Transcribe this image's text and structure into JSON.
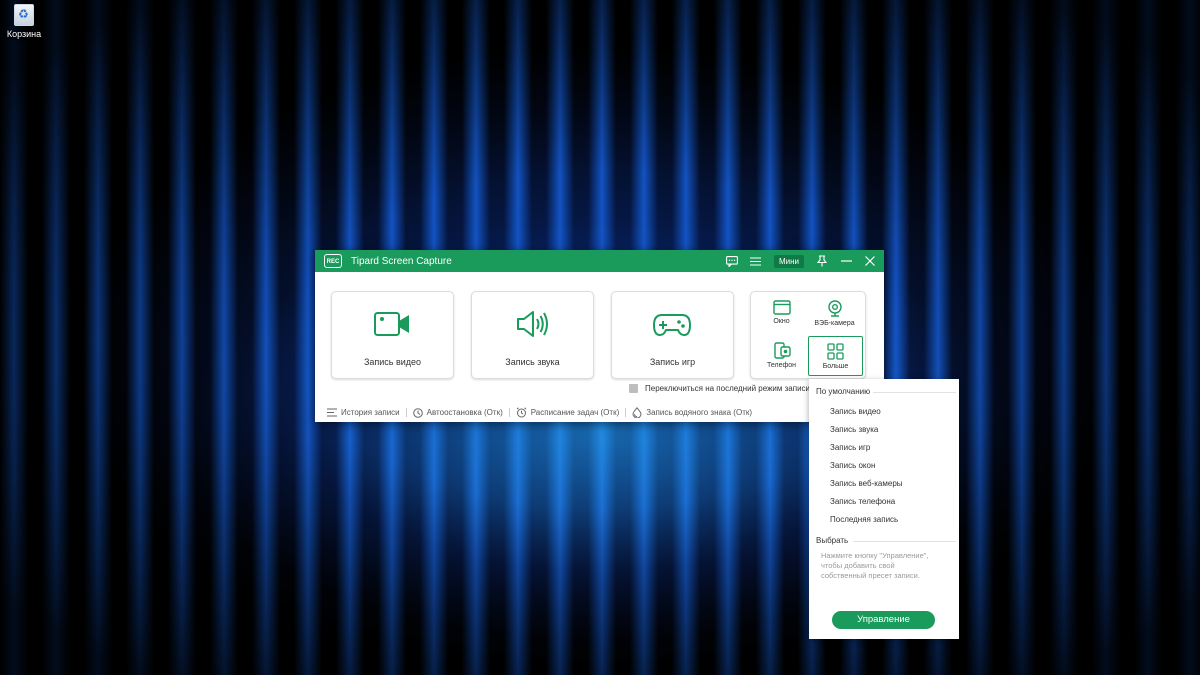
{
  "desktop": {
    "recycle_bin_label": "Корзина"
  },
  "app": {
    "title": "Tipard Screen Capture",
    "logo_text": "REC",
    "mini_label": "Мини",
    "accent": "#1a9b5c",
    "cards": [
      {
        "label": "Запись видео",
        "icon": "video-camera-icon"
      },
      {
        "label": "Запись звука",
        "icon": "speaker-icon"
      },
      {
        "label": "Запись игр",
        "icon": "gamepad-icon"
      }
    ],
    "small_items": [
      {
        "label": "Окно",
        "icon": "window-icon"
      },
      {
        "label": "ВЭБ-камера",
        "icon": "webcam-icon"
      },
      {
        "label": "Телефон",
        "icon": "phone-icon"
      },
      {
        "label": "Больше",
        "icon": "grid-icon"
      }
    ],
    "switch_label": "Переключиться на последний режим записи",
    "bottom": [
      {
        "label": "История записи",
        "icon": "list-icon"
      },
      {
        "label": "Автоостановка (Отк)",
        "icon": "clock-icon"
      },
      {
        "label": "Расписание задач (Отк)",
        "icon": "alarm-icon"
      },
      {
        "label": "Запись водяного знака (Отк)",
        "icon": "drop-icon"
      }
    ]
  },
  "dropdown": {
    "default_header": "По умолчанию",
    "items": [
      "Запись видео",
      "Запись звука",
      "Запись игр",
      "Запись окон",
      "Запись веб-камеры",
      "Запись телефона",
      "Последняя запись"
    ],
    "custom_header": "Выбрать",
    "hint": "Нажмите кнопку \"Управление\", чтобы добавить свой собственный пресет записи.",
    "manage_label": "Управление"
  }
}
